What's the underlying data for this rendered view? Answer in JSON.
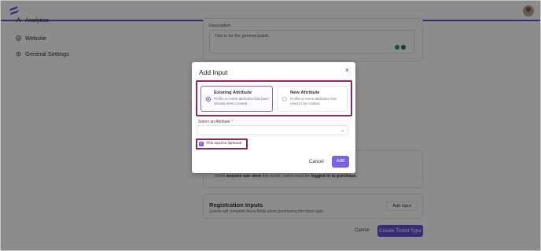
{
  "colors": {
    "accent": "#6b4fd8",
    "highlight": "#8a2a5e"
  },
  "sidebar": {
    "items": [
      {
        "label": "Analytics",
        "icon": "analytics-icon"
      },
      {
        "label": "Website",
        "icon": "globe-icon"
      },
      {
        "label": "General Settings",
        "icon": "gear-icon"
      }
    ]
  },
  "form": {
    "description_label": "Description",
    "description_value": "This is for the general public.",
    "visibility_prefix": "While ",
    "visibility_bold1": "anyone can view",
    "visibility_mid": " this ticket, users must be ",
    "visibility_bold2": "logged in to purchase.",
    "registration_title": "Registration Inputs",
    "registration_subtitle": "Guests will complete these fields when purchasing this ticket type",
    "add_input_label": "Add Input",
    "cancel_label": "Cancel",
    "create_label": "Create Ticket Type"
  },
  "modal": {
    "title": "Add Input",
    "close_icon": "×",
    "options": [
      {
        "title": "Existing Attribute",
        "desc": "Profile or event attributes that have already been created",
        "selected": true
      },
      {
        "title": "New Attribute",
        "desc": "Profile or event attributes that need to be created",
        "selected": false
      }
    ],
    "select_label": "Select an Attribute",
    "required_mark": "*",
    "select_chevron": "⌄",
    "optional_label": "This Input is Optional",
    "optional_checked": true,
    "check_mark": "✓",
    "cancel_label": "Cancel",
    "add_label": "Add"
  }
}
